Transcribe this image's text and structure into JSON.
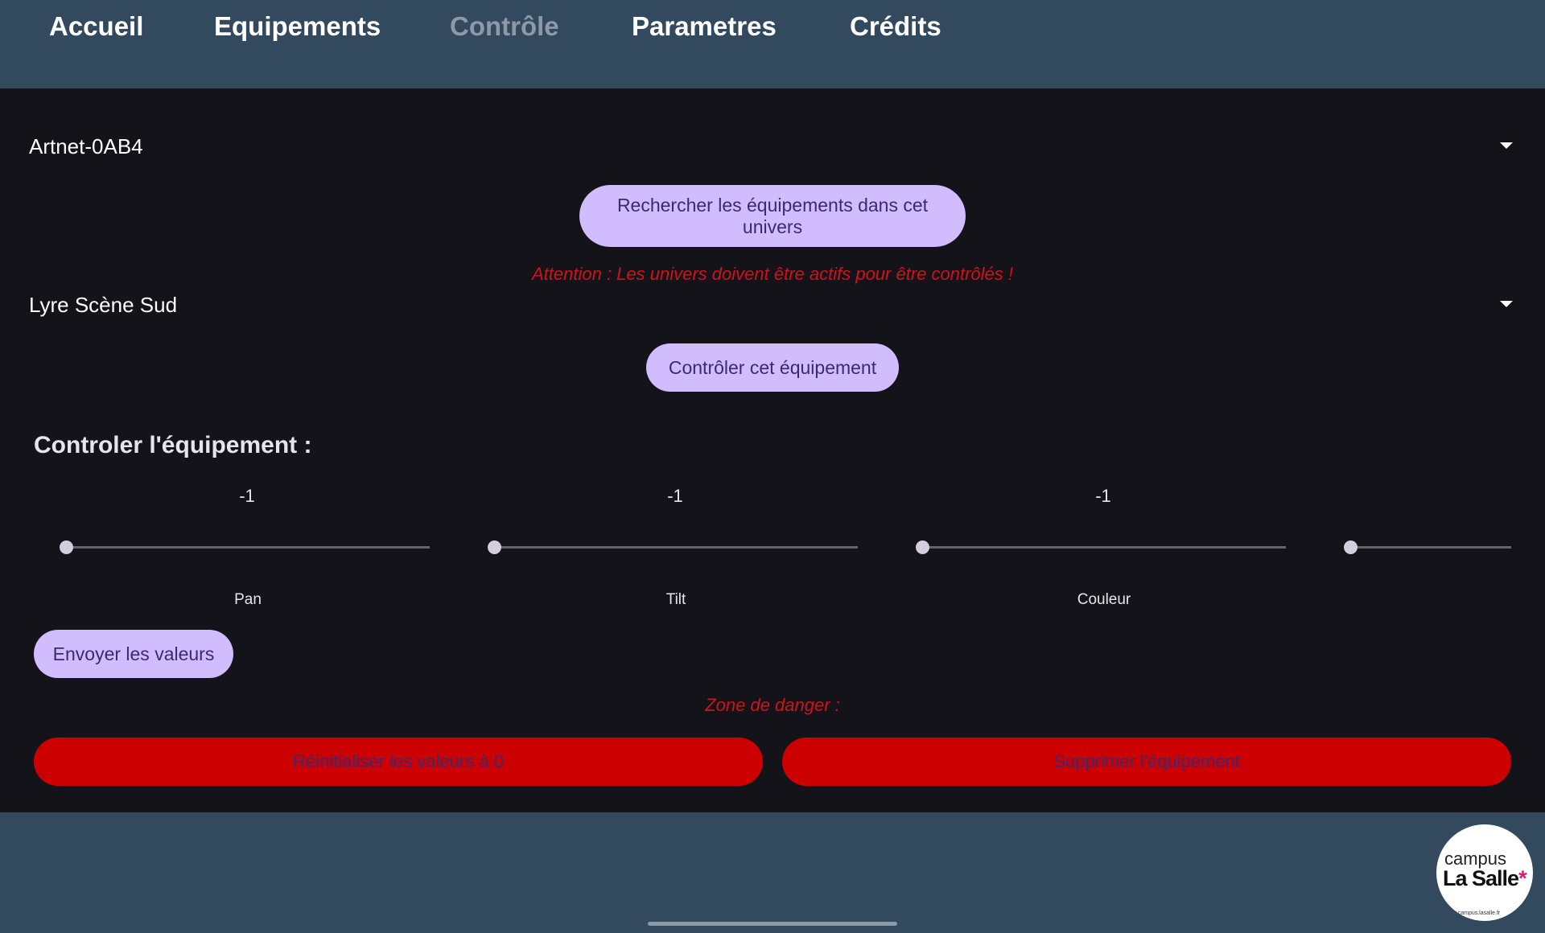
{
  "nav": {
    "items": [
      {
        "label": "Accueil"
      },
      {
        "label": "Equipements"
      },
      {
        "label": "Contrôle"
      },
      {
        "label": "Parametres"
      },
      {
        "label": "Crédits"
      }
    ],
    "active_index": 2
  },
  "universe_select": {
    "value": "Artnet-0AB4"
  },
  "search_button": {
    "label": "Rechercher les équipements dans cet univers"
  },
  "warning": {
    "text": "Attention : Les univers doivent être actifs pour être contrôlés !"
  },
  "equipment_select": {
    "value": "Lyre Scène Sud"
  },
  "control_button": {
    "label": "Contrôler cet équipement"
  },
  "control_section": {
    "title": "Controler l'équipement :",
    "sliders": [
      {
        "value": "-1",
        "label": "Pan"
      },
      {
        "value": "-1",
        "label": "Tilt"
      },
      {
        "value": "-1",
        "label": "Couleur"
      },
      {
        "value": "",
        "label": ""
      }
    ]
  },
  "send_button": {
    "label": "Envoyer les valeurs"
  },
  "danger": {
    "title": "Zone de danger :",
    "reset_label": "Réinitialiser les valeurs à 0",
    "delete_label": "Supprimer l'équipement"
  },
  "logo": {
    "line1": "campus",
    "line2": "La Salle",
    "star": "*",
    "url": "www.campus.lasalle.fr"
  },
  "colors": {
    "nav_bg": "#33495e",
    "content_bg": "#14131a",
    "pill": "#d1bcfe",
    "danger": "#cc0000",
    "warning": "#d0121b"
  }
}
